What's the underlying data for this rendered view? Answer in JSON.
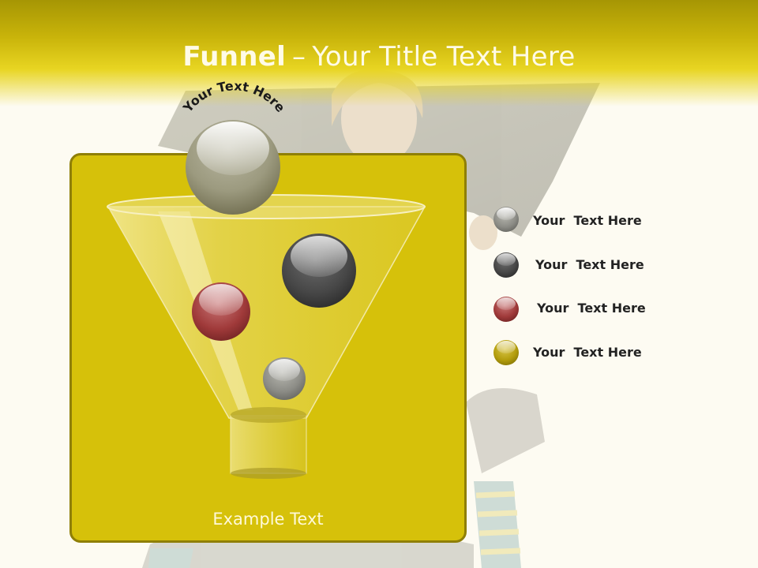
{
  "slide": {
    "title_bold": "Funnel",
    "title_separator": "–",
    "title_rest": "Your Title Text Here",
    "arc_text": "Your Text Here",
    "example_text": "Example Text"
  },
  "legend": {
    "items": [
      {
        "label": "Your  Text Here",
        "color": "#8a8a8a"
      },
      {
        "label": "Your  Text Here",
        "color": "#4a4a4a"
      },
      {
        "label": "Your  Text Here",
        "color": "#a03a3a"
      },
      {
        "label": "Your  Text Here",
        "color": "#b8a20a"
      }
    ]
  },
  "colors": {
    "header": "#e8d522",
    "panel": "#d6c10a",
    "panel_border": "#8f7f06",
    "background": "#fdfbf2"
  }
}
